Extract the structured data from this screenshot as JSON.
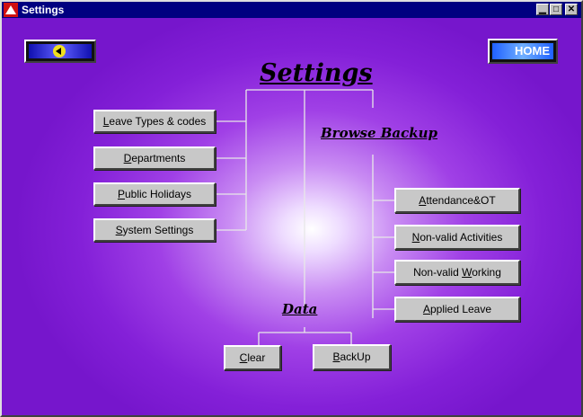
{
  "window": {
    "title": "Settings"
  },
  "nav": {
    "home_label": "HOME"
  },
  "main": {
    "heading": "Settings"
  },
  "settings_buttons": [
    {
      "pre": "",
      "mn": "L",
      "post": "eave Types & codes"
    },
    {
      "pre": "",
      "mn": "D",
      "post": "epartments"
    },
    {
      "pre": "",
      "mn": "P",
      "post": "ublic Holidays"
    },
    {
      "pre": "",
      "mn": "S",
      "post": "ystem Settings"
    }
  ],
  "browse_backup": {
    "heading": "Browse Backup",
    "buttons": [
      {
        "pre": "",
        "mn": "A",
        "post": "ttendance&OT"
      },
      {
        "pre": "",
        "mn": "N",
        "post": "on-valid Activities"
      },
      {
        "pre": "Non-valid ",
        "mn": "W",
        "post": "orking"
      },
      {
        "pre": "",
        "mn": "A",
        "post": "pplied Leave"
      }
    ]
  },
  "data_section": {
    "heading": "Data",
    "buttons": [
      {
        "pre": "",
        "mn": "C",
        "post": "lear"
      },
      {
        "pre": "",
        "mn": "B",
        "post": "ackUp"
      }
    ]
  }
}
